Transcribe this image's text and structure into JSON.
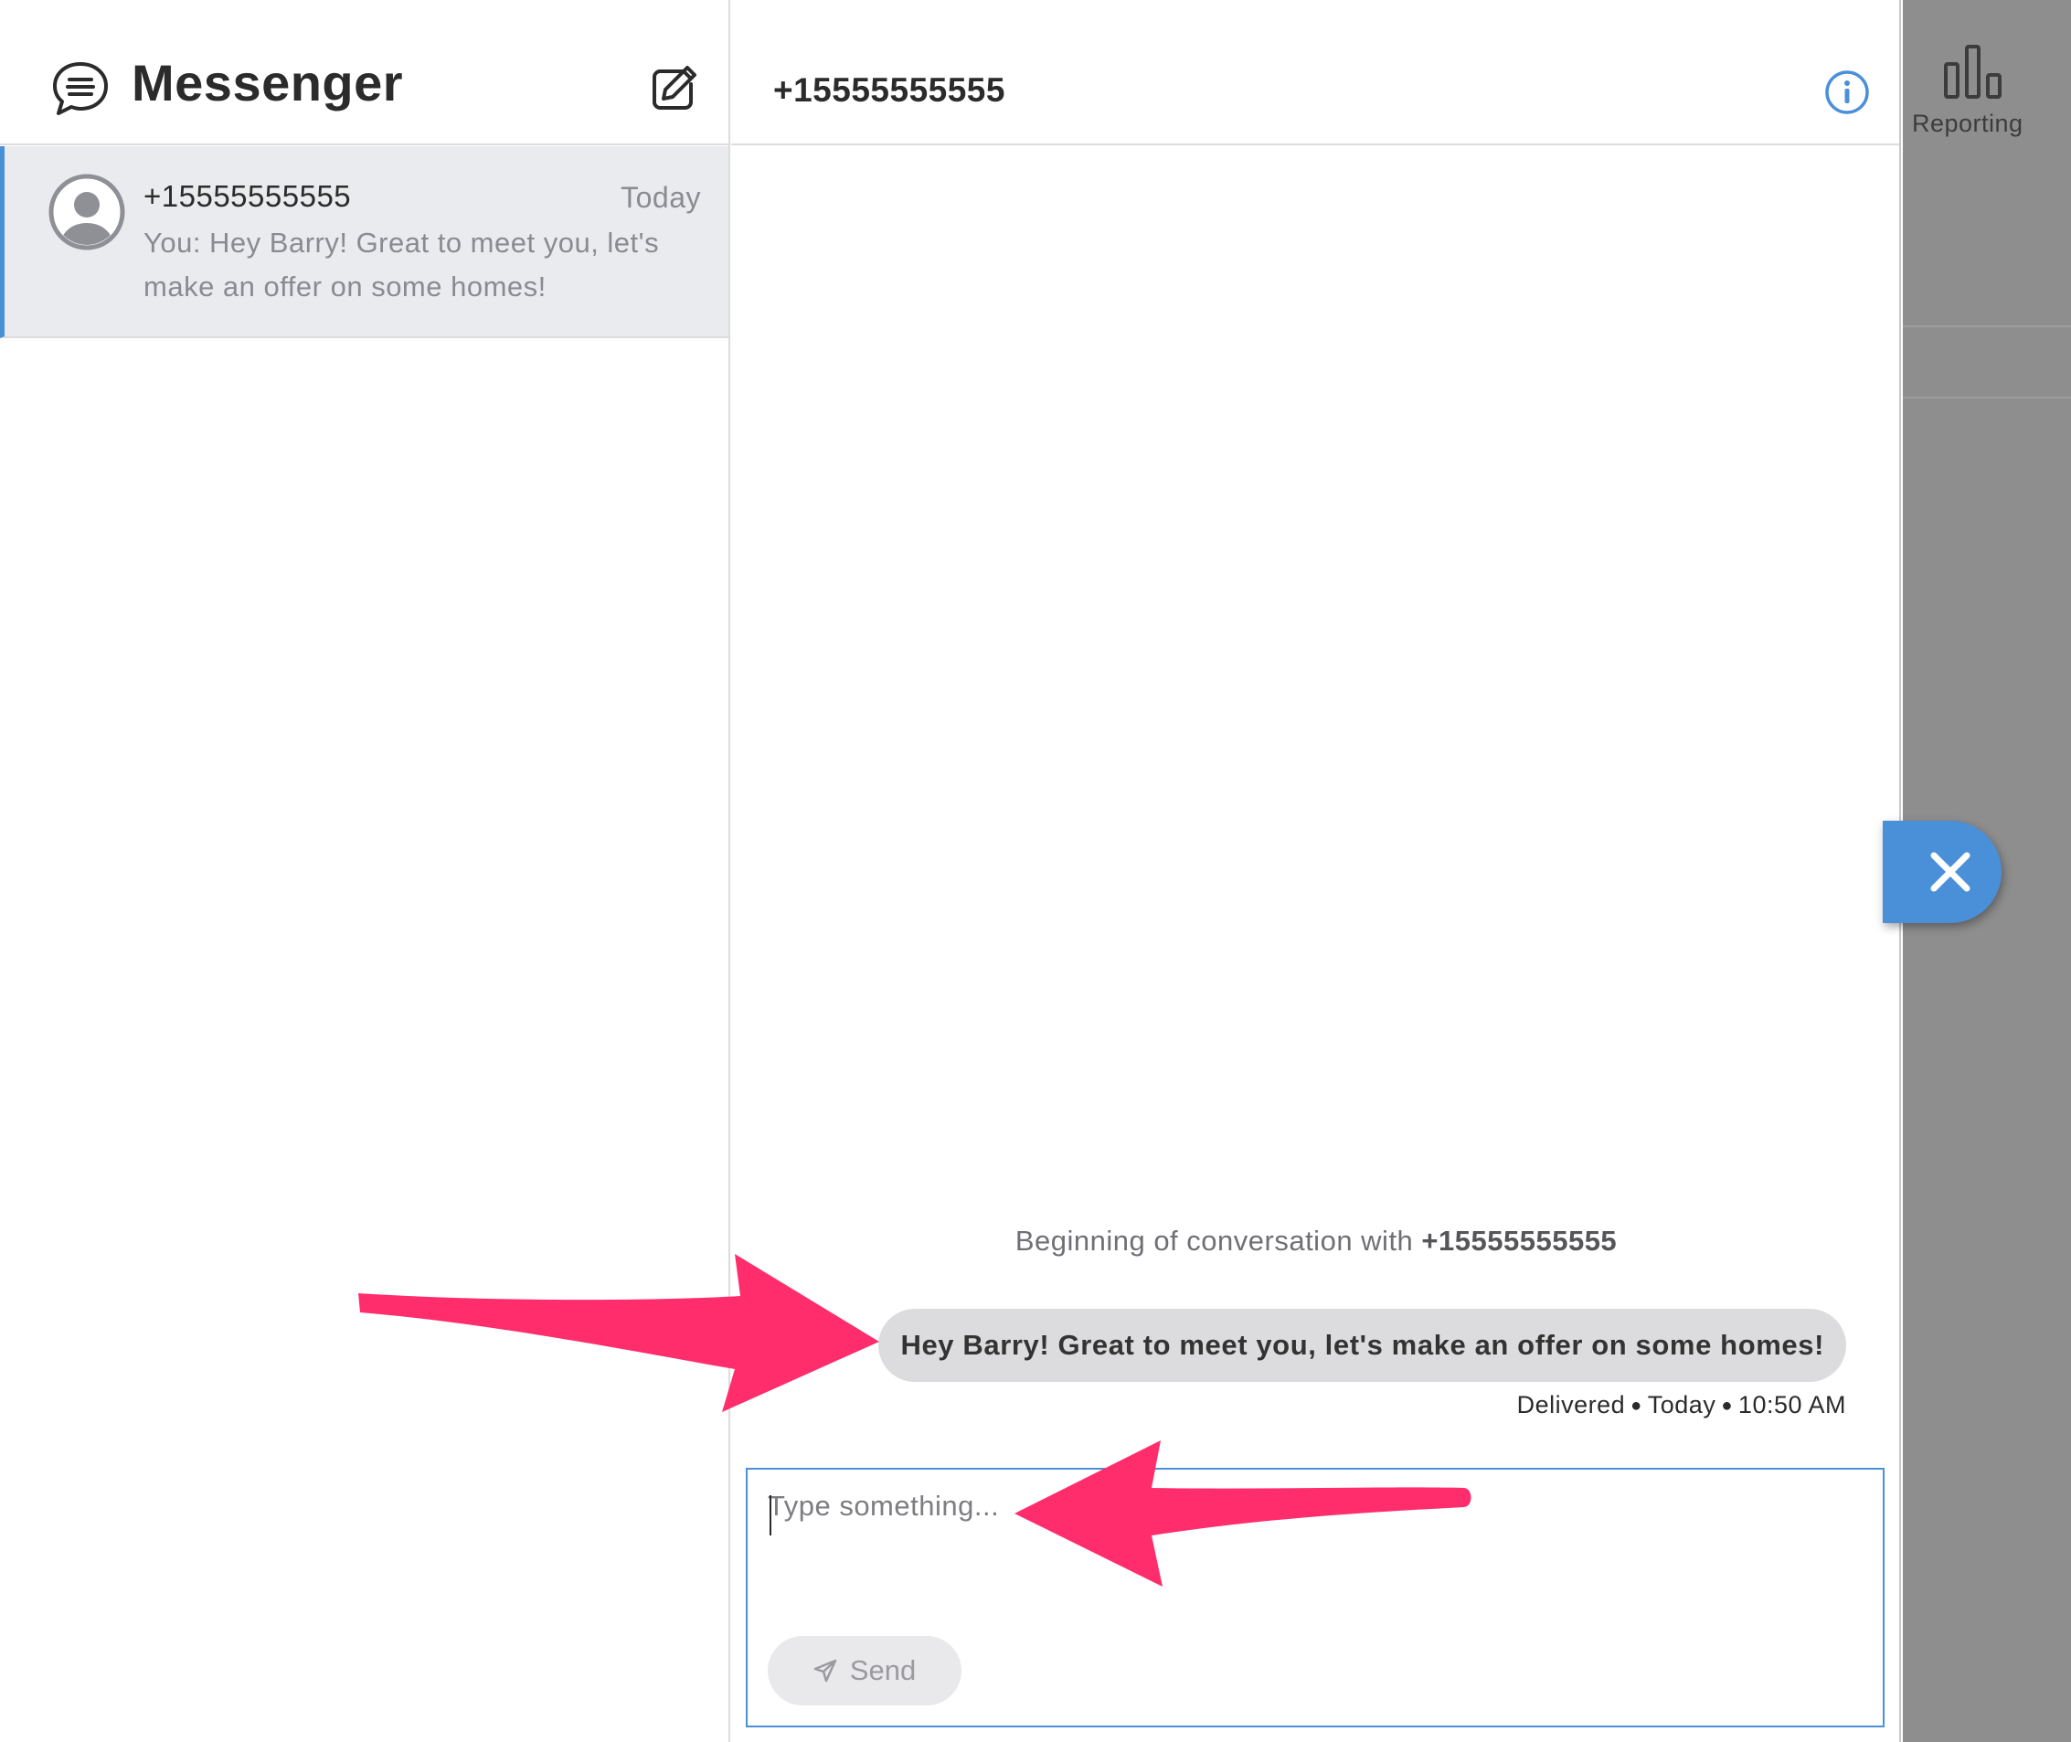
{
  "sidebar": {
    "title": "Messenger",
    "conversations": [
      {
        "phone": "+15555555555",
        "time": "Today",
        "preview": "You: Hey Barry! Great to meet you, let's make an offer on some homes!"
      }
    ]
  },
  "chat": {
    "header_phone": "+15555555555",
    "beginning_prefix": "Beginning of conversation with ",
    "beginning_phone": "+15555555555",
    "messages": [
      {
        "text": "Hey Barry! Great to meet you, let's make an offer on some homes!",
        "status": "Delivered",
        "day": "Today",
        "time": "10:50 AM"
      }
    ],
    "composer": {
      "placeholder": "Type something...",
      "send_label": "Send"
    }
  },
  "background_app": {
    "nav_label": "Reporting"
  },
  "icons": {
    "messenger": "chat-bubble-icon",
    "compose": "compose-icon",
    "avatar": "user-avatar-icon",
    "info": "info-icon",
    "send": "paper-plane-icon",
    "reporting": "bar-chart-icon",
    "close": "close-icon"
  },
  "colors": {
    "accent": "#4a90d9",
    "annotation_arrow": "#ff2d6b",
    "selected_row": "#eaebee",
    "bubble": "#dcdcde",
    "overlay": "#8e8e8e"
  }
}
